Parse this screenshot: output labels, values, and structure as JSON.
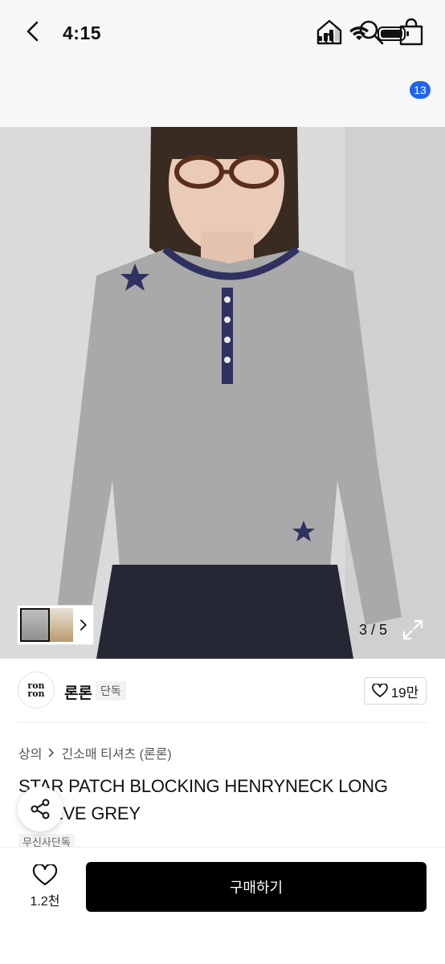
{
  "status_bar": {
    "time": "4:15"
  },
  "nav": {
    "cart_count": "13"
  },
  "gallery": {
    "counter": "3 / 5"
  },
  "brand": {
    "logo_text": "ron ron",
    "name": "론론",
    "tag": "단독"
  },
  "like": {
    "count": "19만"
  },
  "breadcrumb": {
    "category": "상의",
    "subcategory": "긴소매 티셔츠 (론론)"
  },
  "product": {
    "title": "STAR PATCH BLOCKING HENRYNECK LONG SLEEVE GREY",
    "exclusive_tag": "무신사단독"
  },
  "bottom_bar": {
    "wish_count": "1.2천",
    "buy_label": "구매하기"
  },
  "colors": {
    "accent_badge": "#1e63f0",
    "buy_button": "#000000"
  }
}
